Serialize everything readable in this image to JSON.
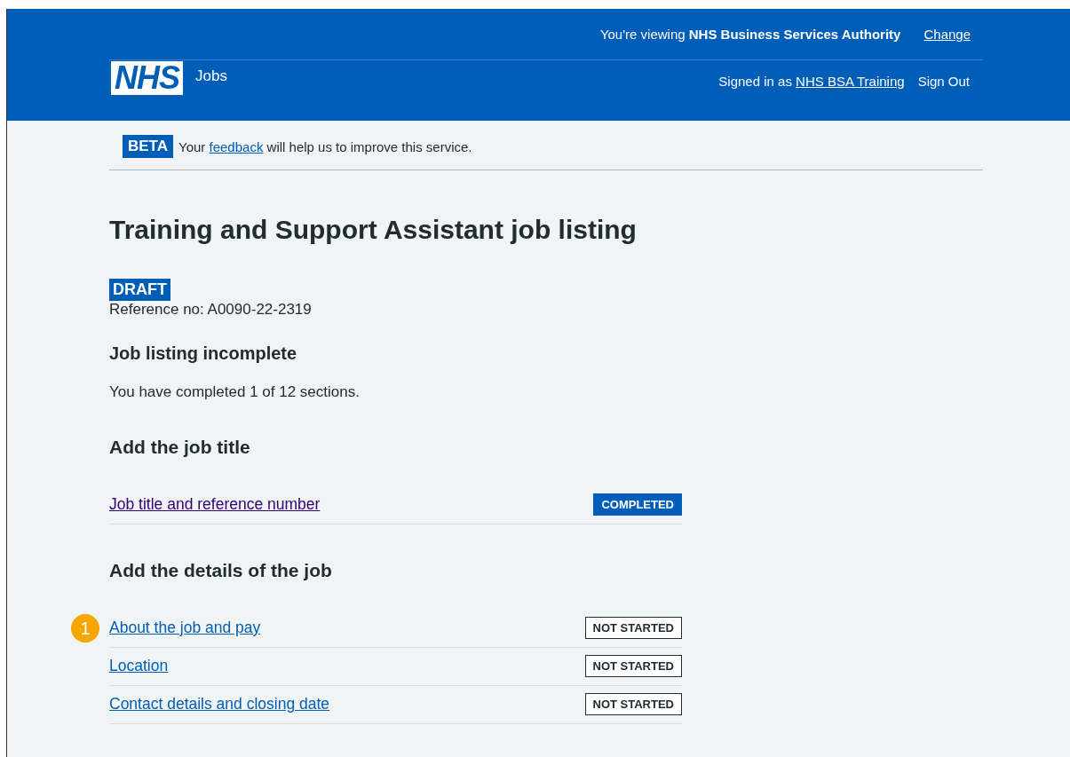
{
  "header": {
    "logo": "NHS",
    "service": "Jobs",
    "viewing_prefix": "You're viewing ",
    "organisation": "NHS Business Services Authority",
    "change_link": "Change",
    "signed_in_prefix": "Signed in as ",
    "user_link": "NHS BSA Training",
    "sign_out": "Sign Out"
  },
  "phase_banner": {
    "tag": "BETA",
    "text_before": "Your ",
    "link": "feedback",
    "text_after": " will help us to improve this service."
  },
  "title": "Training and Support Assistant job listing",
  "status_tag": "DRAFT",
  "reference": "Reference no: A0090-22-2319",
  "progress": {
    "heading": "Job listing incomplete",
    "text": "You have completed 1 of 12 sections."
  },
  "sections": [
    {
      "heading": "Add the job title",
      "tasks": [
        {
          "label": "Job title and reference number",
          "visited": true,
          "status": "COMPLETED",
          "kind": "completed"
        }
      ]
    },
    {
      "heading": "Add the details of the job",
      "tasks": [
        {
          "label": "About the job and pay",
          "visited": false,
          "status": "NOT STARTED",
          "kind": "not_started",
          "marker": "1"
        },
        {
          "label": "Location",
          "visited": false,
          "status": "NOT STARTED",
          "kind": "not_started"
        },
        {
          "label": "Contact details and closing date",
          "visited": false,
          "status": "NOT STARTED",
          "kind": "not_started"
        }
      ]
    }
  ]
}
